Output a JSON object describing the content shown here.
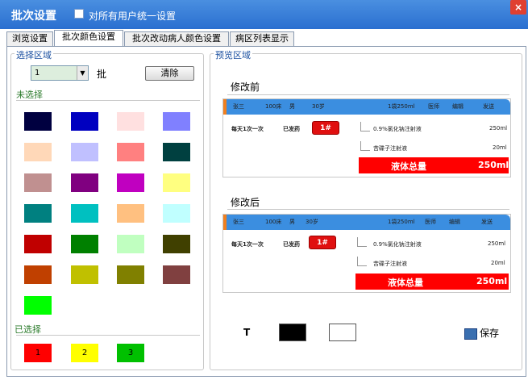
{
  "window": {
    "title": "批次设置",
    "apply_all_label": "对所有用户统一设置",
    "close_glyph": "×"
  },
  "tabs": [
    {
      "label": "浏览设置"
    },
    {
      "label": "批次颜色设置"
    },
    {
      "label": "批次改动病人颜色设置"
    },
    {
      "label": "病区列表显示"
    }
  ],
  "select_area": {
    "title": "选择区域",
    "batch_value": "1",
    "batch_suffix": "批",
    "clear_label": "清除",
    "unselected_title": "未选择",
    "unselected_colors": [
      "#000040",
      "#0000c0",
      "#ffe0e0",
      "#8080ff",
      "#ffd8b8",
      "#c0c0ff",
      "#ff8080",
      "#004040",
      "#c09090",
      "#800080",
      "#c000c0",
      "#ffff80",
      "#008080",
      "#00c0c0",
      "#ffc080",
      "#c0ffff",
      "#c00000",
      "#008000",
      "#c0ffc0",
      "#404000",
      "#c04000",
      "#c0c000",
      "#808000",
      "#804040",
      "#00ff00"
    ],
    "selected_title": "已选择",
    "selected": [
      {
        "label": "1",
        "color": "#ff0000"
      },
      {
        "label": "2",
        "color": "#ffff00"
      },
      {
        "label": "3",
        "color": "#00c000"
      }
    ]
  },
  "preview": {
    "title": "预览区域",
    "before_label": "修改前",
    "after_label": "修改后",
    "header": {
      "c1": "张三",
      "c2": "100床",
      "c3": "男",
      "c4": "30岁",
      "c5": "1袋250ml",
      "c6": "医师",
      "c7": "编辑",
      "c8": "发送"
    },
    "before_header": {
      "c1": "张三",
      "c2": "100床",
      "c3": "男",
      "c4": "30岁",
      "c5": "1袋250ml",
      "c6": "医师",
      "c7": "编辑",
      "c8": "发送"
    },
    "freq": "每天1次一次",
    "status": "已发药",
    "badge": "1#",
    "drug1": "0.9%氯化钠注射液",
    "drug1_qty": "250ml",
    "drug2": "苦碟子注射液",
    "drug2_qty": "20ml",
    "total_label": "液体总量",
    "total_value": "250ml",
    "t_label": "T",
    "swatch_black": "#000000",
    "swatch_white": "#ffffff",
    "save_label": "保存"
  }
}
